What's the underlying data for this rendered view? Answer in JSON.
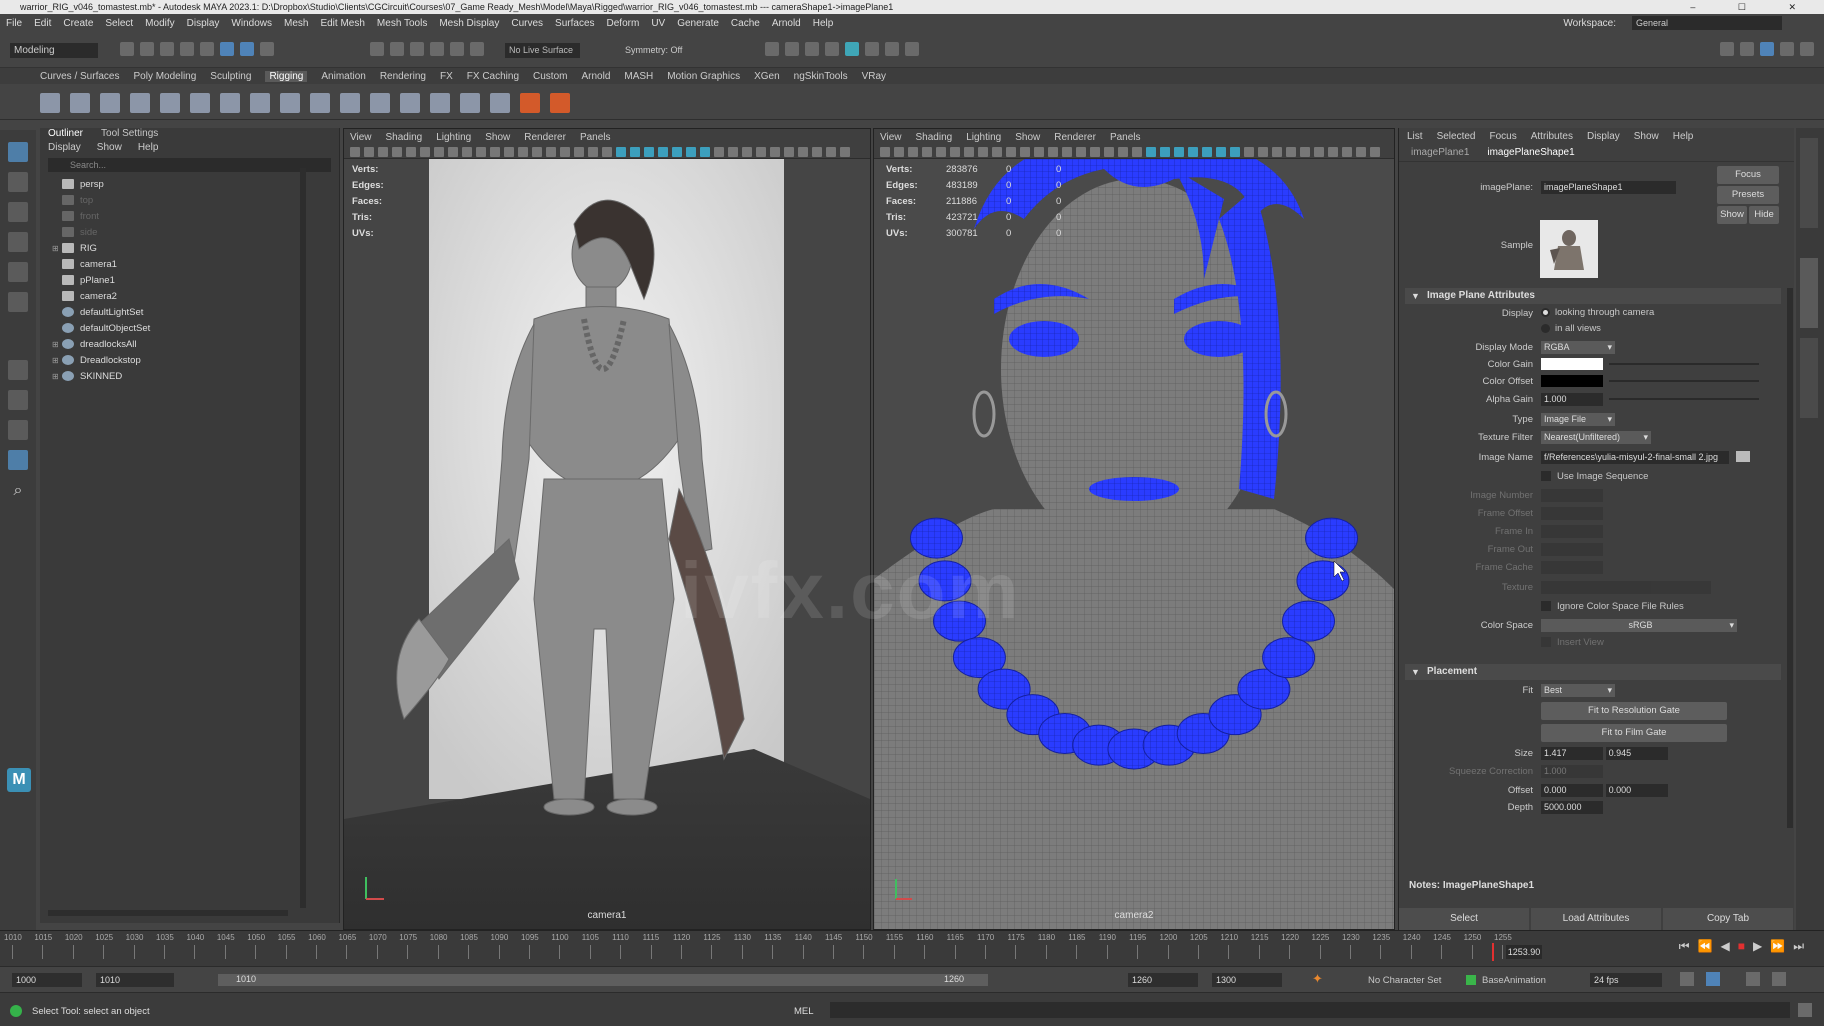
{
  "window": {
    "title": "warrior_RIG_v046_tomastest.mb* - Autodesk MAYA 2023.1: D:\\Dropbox\\Studio\\Clients\\CGCircuit\\Courses\\07_Game Ready_Mesh\\Model\\Maya\\Rigged\\warrior_RIG_v046_tomastest.mb --- cameraShape1->imagePlane1"
  },
  "menubar": {
    "items": [
      "File",
      "Edit",
      "Create",
      "Select",
      "Modify",
      "Display",
      "Windows",
      "Mesh",
      "Edit Mesh",
      "Mesh Tools",
      "Mesh Display",
      "Curves",
      "Surfaces",
      "Deform",
      "UV",
      "Generate",
      "Cache",
      "Arnold",
      "Help"
    ],
    "workspace_label": "Workspace:",
    "workspace_value": "General"
  },
  "statusline": {
    "mode": "Modeling",
    "live_surface": "No Live Surface",
    "symmetry": "Symmetry: Off"
  },
  "shelf": {
    "tabs": [
      "Curves / Surfaces",
      "Poly Modeling",
      "Sculpting",
      "Rigging",
      "Animation",
      "Rendering",
      "FX",
      "FX Caching",
      "Custom",
      "Arnold",
      "MASH",
      "Motion Graphics",
      "XGen",
      "ngSkinTools",
      "VRay"
    ],
    "active_tab": "Rigging"
  },
  "outliner": {
    "tabs": [
      "Outliner",
      "Tool Settings"
    ],
    "menu": [
      "Display",
      "Show",
      "Help"
    ],
    "search_placeholder": "Search...",
    "items": [
      {
        "label": "persp",
        "icon": "camera-icon",
        "dim": false,
        "expand": ""
      },
      {
        "label": "top",
        "icon": "camera-icon",
        "dim": true,
        "expand": ""
      },
      {
        "label": "front",
        "icon": "camera-icon",
        "dim": true,
        "expand": ""
      },
      {
        "label": "side",
        "icon": "camera-icon",
        "dim": true,
        "expand": ""
      },
      {
        "label": "RIG",
        "icon": "transform-icon",
        "dim": false,
        "expand": "⊞"
      },
      {
        "label": "camera1",
        "icon": "camera-icon",
        "dim": false,
        "expand": ""
      },
      {
        "label": "pPlane1",
        "icon": "mesh-icon",
        "dim": false,
        "expand": ""
      },
      {
        "label": "camera2",
        "icon": "camera-icon",
        "dim": false,
        "expand": ""
      },
      {
        "label": "defaultLightSet",
        "icon": "set-icon",
        "dim": false,
        "expand": ""
      },
      {
        "label": "defaultObjectSet",
        "icon": "set-icon",
        "dim": false,
        "expand": ""
      },
      {
        "label": "dreadlocksAll",
        "icon": "set-icon",
        "dim": false,
        "expand": "⊞"
      },
      {
        "label": "Dreadlockstop",
        "icon": "set-icon",
        "dim": false,
        "expand": "⊞"
      },
      {
        "label": "SKINNED",
        "icon": "set-icon",
        "dim": false,
        "expand": "⊞"
      }
    ]
  },
  "viewport1": {
    "menu": [
      "View",
      "Shading",
      "Lighting",
      "Show",
      "Renderer",
      "Panels"
    ],
    "hud_labels": [
      "Verts:",
      "Edges:",
      "Faces:",
      "Tris:",
      "UVs:"
    ],
    "camera": "camera1"
  },
  "viewport2": {
    "menu": [
      "View",
      "Shading",
      "Lighting",
      "Show",
      "Renderer",
      "Panels"
    ],
    "hud": [
      {
        "k": "Verts:",
        "v": "283876",
        "a": "0",
        "b": "0"
      },
      {
        "k": "Edges:",
        "v": "483189",
        "a": "0",
        "b": "0"
      },
      {
        "k": "Faces:",
        "v": "211886",
        "a": "0",
        "b": "0"
      },
      {
        "k": "Tris:",
        "v": "423721",
        "a": "0",
        "b": "0"
      },
      {
        "k": "UVs:",
        "v": "300781",
        "a": "0",
        "b": "0"
      }
    ],
    "camera": "camera2"
  },
  "watermark": "ivfx.com",
  "attribute_editor": {
    "menu": [
      "List",
      "Selected",
      "Focus",
      "Attributes",
      "Display",
      "Show",
      "Help"
    ],
    "tabs": [
      "imagePlane1",
      "imagePlaneShape1"
    ],
    "imageplane_label": "imagePlane:",
    "imageplane_value": "imagePlaneShape1",
    "focus": "Focus",
    "presets": "Presets",
    "show": "Show",
    "hide": "Hide",
    "sample_label": "Sample",
    "section_attrs": "Image Plane Attributes",
    "display_label": "Display",
    "display_opt1": "looking through camera",
    "display_opt2": "in all views",
    "display_mode_label": "Display Mode",
    "display_mode": "RGBA",
    "color_gain": "Color Gain",
    "color_offset": "Color Offset",
    "alpha_gain_label": "Alpha Gain",
    "alpha_gain": "1.000",
    "type_label": "Type",
    "type": "Image File",
    "texture_filter_label": "Texture Filter",
    "texture_filter": "Nearest(Unfiltered)",
    "image_name_label": "Image Name",
    "image_name": "f/References\\yulia-misyul-2-final-small 2.jpg",
    "use_seq": "Use Image Sequence",
    "image_number": "Image Number",
    "frame_offset": "Frame Offset",
    "frame_in": "Frame In",
    "frame_out": "Frame Out",
    "frame_cache": "Frame Cache",
    "texture": "Texture",
    "ignore_cs": "Ignore Color Space File Rules",
    "color_space_label": "Color Space",
    "color_space": "sRGB",
    "insert_view": "Insert View",
    "section_placement": "Placement",
    "fit_label": "Fit",
    "fit": "Best",
    "fit_res": "Fit to Resolution Gate",
    "fit_film": "Fit to Film Gate",
    "size_label": "Size",
    "size_x": "1.417",
    "size_y": "0.945",
    "squeeze": "Squeeze Correction",
    "squeeze_val": "1.000",
    "offset_label": "Offset",
    "offset_x": "0.000",
    "offset_y": "0.000",
    "depth_label": "Depth",
    "depth": "5000.000",
    "notes": "Notes: ImagePlaneShape1",
    "btn_select": "Select",
    "btn_load": "Load Attributes",
    "btn_copy": "Copy Tab"
  },
  "timeline": {
    "ticks": [
      "1010",
      "1015",
      "1020",
      "1025",
      "1030",
      "1035",
      "1040",
      "1045",
      "1050",
      "1055",
      "1060",
      "1065",
      "1070",
      "1075",
      "1080",
      "1085",
      "1090",
      "1095",
      "1100",
      "1105",
      "1110",
      "1115",
      "1120",
      "1125",
      "1130",
      "1135",
      "1140",
      "1145",
      "1150",
      "1155",
      "1160",
      "1165",
      "1170",
      "1175",
      "1180",
      "1185",
      "1190",
      "1195",
      "1200",
      "1205",
      "1210",
      "1215",
      "1220",
      "1225",
      "1230",
      "1235",
      "1240",
      "1245",
      "1250",
      "1255"
    ],
    "current": "1253.90"
  },
  "range": {
    "start": "1000",
    "inner_start": "1010",
    "bar_start": "1010",
    "bar_end": "1260",
    "inner_end": "1260",
    "end": "1300",
    "character_set": "No Character Set",
    "anim_layer": "BaseAnimation",
    "fps": "24 fps"
  },
  "command": {
    "help": "Select Tool: select an object",
    "lang": "MEL"
  },
  "colors": {
    "accent": "#4f83b8",
    "wire_blue": "#2a3cff"
  }
}
